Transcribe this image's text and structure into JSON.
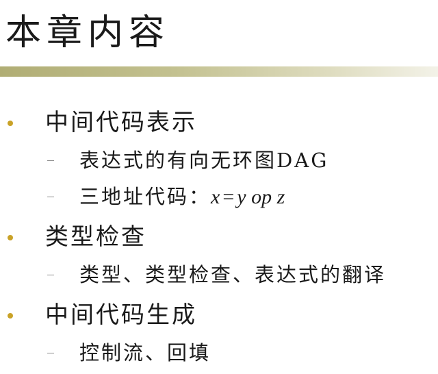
{
  "slide": {
    "title": "本章内容"
  },
  "outline": [
    {
      "text": "中间代码表示",
      "children": [
        {
          "text": "表达式的有向无环图DAG"
        },
        {
          "text": "三地址代码：",
          "formula": {
            "lhs": "x",
            "eq": "=",
            "rhs1": "y",
            "op": "op",
            "rhs2": "z"
          }
        }
      ]
    },
    {
      "text": "类型检查",
      "children": [
        {
          "text": "类型、类型检查、表达式的翻译"
        }
      ]
    },
    {
      "text": "中间代码生成",
      "children": [
        {
          "text": "控制流、回填"
        }
      ]
    }
  ],
  "colors": {
    "bullet": "#c9a227",
    "rule_start": "#b0ad74",
    "rule_end": "#f3f2e8",
    "text": "#1a1a1a"
  }
}
